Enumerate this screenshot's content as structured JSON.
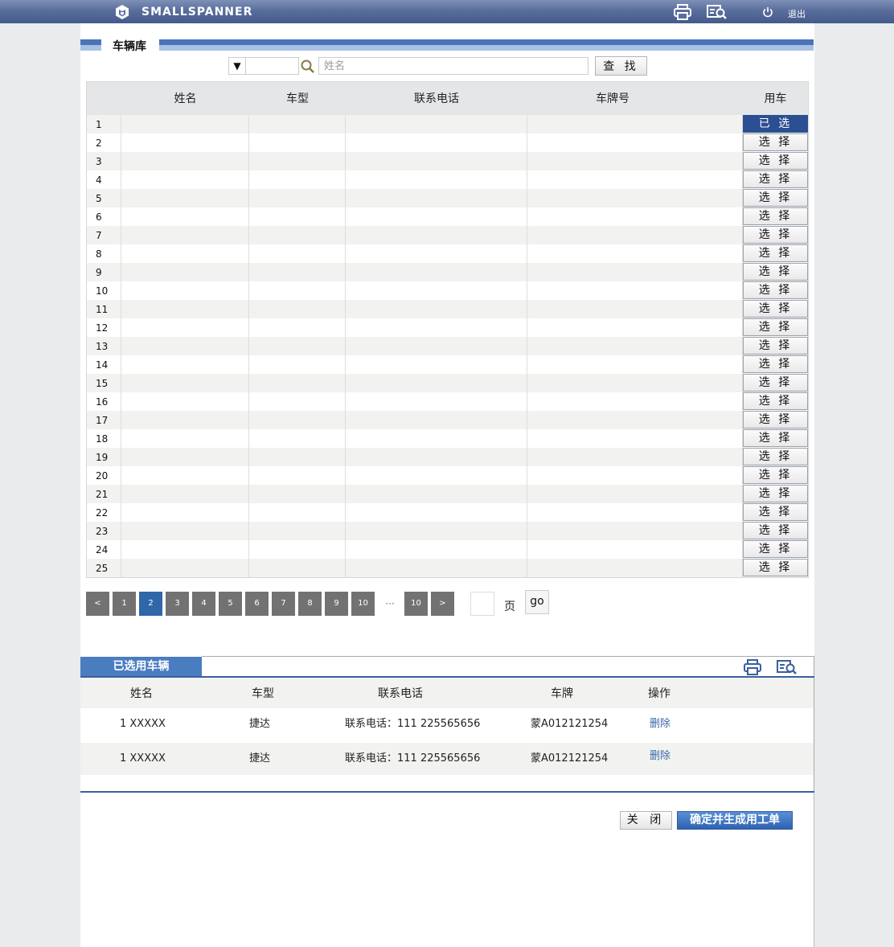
{
  "app": {
    "brand": "SMALLSPANNER",
    "logout_label": "退出"
  },
  "icons": {
    "logo": "box-logo-icon",
    "print": "printer-icon",
    "preview": "print-preview-icon",
    "logout": "power-icon",
    "search": "search-icon"
  },
  "library": {
    "title": "车辆库",
    "search": {
      "dropdown_glyph": "▼",
      "placeholder": "姓名",
      "button": "查 找"
    },
    "columns": [
      "姓名",
      "车型",
      "联系电话",
      "车牌号",
      "用车"
    ],
    "rows": [
      {
        "n": "1",
        "action": "已 选",
        "selected": true
      },
      {
        "n": "2",
        "action": "选 择"
      },
      {
        "n": "3",
        "action": "选 择"
      },
      {
        "n": "4",
        "action": "选 择"
      },
      {
        "n": "5",
        "action": "选 择"
      },
      {
        "n": "6",
        "action": "选 择"
      },
      {
        "n": "7",
        "action": "选 择"
      },
      {
        "n": "8",
        "action": "选 择"
      },
      {
        "n": "9",
        "action": "选 择"
      },
      {
        "n": "10",
        "action": "选 择"
      },
      {
        "n": "11",
        "action": "选 择"
      },
      {
        "n": "12",
        "action": "选 择"
      },
      {
        "n": "13",
        "action": "选 择"
      },
      {
        "n": "14",
        "action": "选 择"
      },
      {
        "n": "15",
        "action": "选 择"
      },
      {
        "n": "16",
        "action": "选 择"
      },
      {
        "n": "17",
        "action": "选 择"
      },
      {
        "n": "18",
        "action": "选 择"
      },
      {
        "n": "19",
        "action": "选 择"
      },
      {
        "n": "20",
        "action": "选 择"
      },
      {
        "n": "21",
        "action": "选 择"
      },
      {
        "n": "22",
        "action": "选 择"
      },
      {
        "n": "23",
        "action": "选 择"
      },
      {
        "n": "24",
        "action": "选 择"
      },
      {
        "n": "25",
        "action": "选 择"
      }
    ]
  },
  "pagination": {
    "items": [
      "<",
      "1",
      "2",
      "3",
      "4",
      "5",
      "6",
      "7",
      "8",
      "9",
      "10",
      "···",
      "10",
      ">"
    ],
    "current": "2",
    "page_label": "页",
    "go_label": "go"
  },
  "selected": {
    "title": "已选用车辆",
    "columns": [
      "姓名",
      "车型",
      "联系电话",
      "车牌",
      "操作"
    ],
    "rows": [
      {
        "name": "1 XXXXX",
        "model": "捷达",
        "phone": "联系电话：111 225565656",
        "plate": "蒙A012121254",
        "action": "删除"
      },
      {
        "name": "1 XXXXX",
        "model": "捷达",
        "phone": "联系电话：111 225565656",
        "plate": "蒙A012121254",
        "action": "删除"
      }
    ]
  },
  "footer": {
    "close": "关 闭",
    "confirm": "确定并生成用工单"
  }
}
